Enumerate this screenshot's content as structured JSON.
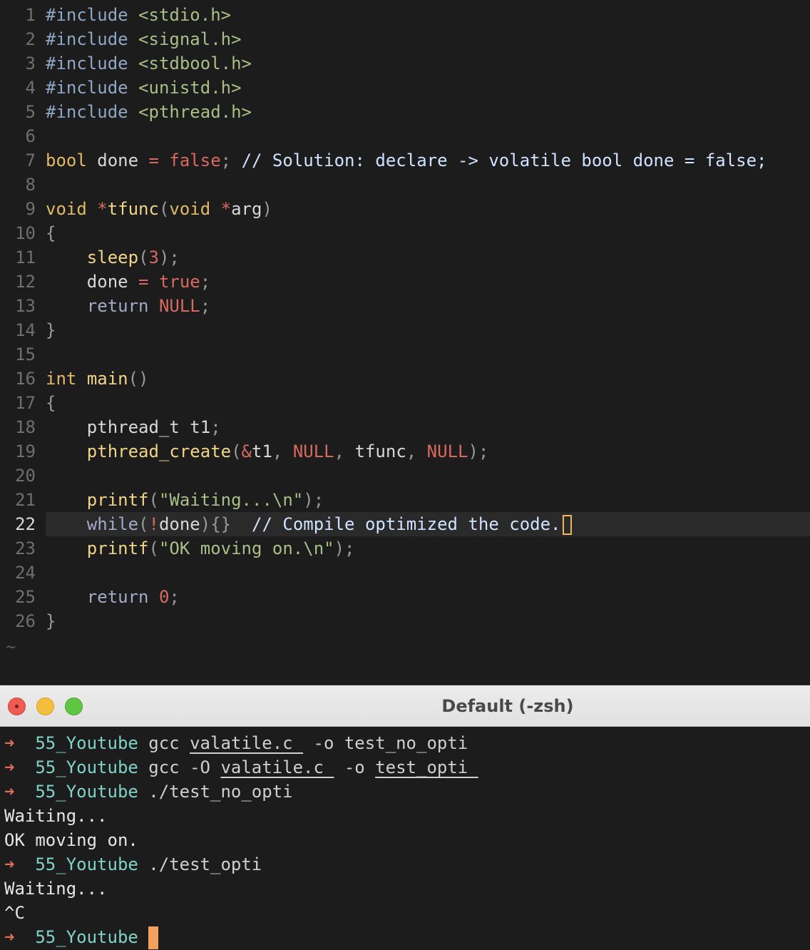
{
  "editor": {
    "lines": [
      {
        "n": "1",
        "parts": [
          [
            "pre",
            "#include "
          ],
          [
            "str",
            "<stdio.h>"
          ]
        ]
      },
      {
        "n": "2",
        "parts": [
          [
            "pre",
            "#include "
          ],
          [
            "str",
            "<signal.h>"
          ]
        ]
      },
      {
        "n": "3",
        "parts": [
          [
            "pre",
            "#include "
          ],
          [
            "str",
            "<stdbool.h>"
          ]
        ]
      },
      {
        "n": "4",
        "parts": [
          [
            "pre",
            "#include "
          ],
          [
            "str",
            "<unistd.h>"
          ]
        ]
      },
      {
        "n": "5",
        "parts": [
          [
            "pre",
            "#include "
          ],
          [
            "str",
            "<pthread.h>"
          ]
        ]
      },
      {
        "n": "6",
        "parts": []
      },
      {
        "n": "7",
        "parts": [
          [
            "type",
            "bool"
          ],
          [
            "txt",
            " done "
          ],
          [
            "op",
            "="
          ],
          [
            "txt",
            " "
          ],
          [
            "const",
            "false"
          ],
          [
            "punc",
            ";"
          ],
          [
            "txt",
            " "
          ],
          [
            "cmt",
            "// Solution: declare -> volatile bool done = false;"
          ]
        ]
      },
      {
        "n": "8",
        "parts": []
      },
      {
        "n": "9",
        "parts": [
          [
            "type",
            "void"
          ],
          [
            "txt",
            " "
          ],
          [
            "op",
            "*"
          ],
          [
            "fn",
            "tfunc"
          ],
          [
            "punc",
            "("
          ],
          [
            "type",
            "void"
          ],
          [
            "txt",
            " "
          ],
          [
            "op",
            "*"
          ],
          [
            "txt",
            "arg"
          ],
          [
            "punc",
            ")"
          ]
        ]
      },
      {
        "n": "10",
        "parts": [
          [
            "punc",
            "{"
          ]
        ]
      },
      {
        "n": "11",
        "parts": [
          [
            "txt",
            "    "
          ],
          [
            "fn",
            "sleep"
          ],
          [
            "punc",
            "("
          ],
          [
            "const",
            "3"
          ],
          [
            "punc",
            ");"
          ]
        ]
      },
      {
        "n": "12",
        "parts": [
          [
            "txt",
            "    done "
          ],
          [
            "op",
            "="
          ],
          [
            "txt",
            " "
          ],
          [
            "const",
            "true"
          ],
          [
            "punc",
            ";"
          ]
        ]
      },
      {
        "n": "13",
        "parts": [
          [
            "txt",
            "    "
          ],
          [
            "kw",
            "return"
          ],
          [
            "txt",
            " "
          ],
          [
            "const",
            "NULL"
          ],
          [
            "punc",
            ";"
          ]
        ]
      },
      {
        "n": "14",
        "parts": [
          [
            "punc",
            "}"
          ]
        ]
      },
      {
        "n": "15",
        "parts": []
      },
      {
        "n": "16",
        "parts": [
          [
            "type",
            "int"
          ],
          [
            "txt",
            " "
          ],
          [
            "fn",
            "main"
          ],
          [
            "punc",
            "()"
          ]
        ]
      },
      {
        "n": "17",
        "parts": [
          [
            "punc",
            "{"
          ]
        ]
      },
      {
        "n": "18",
        "parts": [
          [
            "txt",
            "    pthread_t t1"
          ],
          [
            "punc",
            ";"
          ]
        ]
      },
      {
        "n": "19",
        "parts": [
          [
            "txt",
            "    "
          ],
          [
            "fn",
            "pthread_create"
          ],
          [
            "punc",
            "("
          ],
          [
            "op",
            "&"
          ],
          [
            "txt",
            "t1"
          ],
          [
            "punc",
            ", "
          ],
          [
            "const",
            "NULL"
          ],
          [
            "punc",
            ", "
          ],
          [
            "txt",
            "tfunc"
          ],
          [
            "punc",
            ", "
          ],
          [
            "const",
            "NULL"
          ],
          [
            "punc",
            ");"
          ]
        ]
      },
      {
        "n": "20",
        "parts": []
      },
      {
        "n": "21",
        "parts": [
          [
            "txt",
            "    "
          ],
          [
            "fn",
            "printf"
          ],
          [
            "punc",
            "("
          ],
          [
            "str",
            "\"Waiting...\\n\""
          ],
          [
            "punc",
            ");"
          ]
        ]
      },
      {
        "n": "22",
        "current": true,
        "parts": [
          [
            "txt",
            "    "
          ],
          [
            "kw",
            "while"
          ],
          [
            "punc",
            "("
          ],
          [
            "op",
            "!"
          ],
          [
            "txt",
            "done"
          ],
          [
            "punc",
            "){}"
          ],
          [
            "txt",
            "  "
          ],
          [
            "cmt",
            "// Compile optimized the code."
          ]
        ]
      },
      {
        "n": "23",
        "parts": [
          [
            "txt",
            "    "
          ],
          [
            "fn",
            "printf"
          ],
          [
            "punc",
            "("
          ],
          [
            "str",
            "\"OK moving on.\\n\""
          ],
          [
            "punc",
            ");"
          ]
        ]
      },
      {
        "n": "24",
        "parts": []
      },
      {
        "n": "25",
        "parts": [
          [
            "txt",
            "    "
          ],
          [
            "kw",
            "return"
          ],
          [
            "txt",
            " "
          ],
          [
            "const",
            "0"
          ],
          [
            "punc",
            ";"
          ]
        ]
      },
      {
        "n": "26",
        "parts": [
          [
            "punc",
            "}"
          ]
        ]
      }
    ],
    "tilde": "~"
  },
  "terminal": {
    "title": "Default (-zsh)",
    "lines": [
      {
        "type": "prompt",
        "arrow": "➜",
        "dir": "55_Youtube",
        "cmd": [
          [
            "",
            " gcc "
          ],
          [
            "ul",
            "valatile.c "
          ],
          [
            "",
            " -o test_no_opti"
          ]
        ]
      },
      {
        "type": "prompt",
        "arrow": "➜",
        "dir": "55_Youtube",
        "cmd": [
          [
            "",
            " gcc -O "
          ],
          [
            "ul",
            "valatile.c "
          ],
          [
            "",
            " -o "
          ],
          [
            "ul",
            "test_opti "
          ]
        ]
      },
      {
        "type": "prompt",
        "arrow": "➜",
        "dir": "55_Youtube",
        "cmd": [
          [
            "",
            " ./test_no_opti"
          ]
        ]
      },
      {
        "type": "out",
        "text": "Waiting..."
      },
      {
        "type": "out",
        "text": "OK moving on."
      },
      {
        "type": "prompt",
        "arrow": "➜",
        "dir": "55_Youtube",
        "cmd": [
          [
            "",
            " ./test_opti"
          ]
        ]
      },
      {
        "type": "out",
        "text": "Waiting..."
      },
      {
        "type": "out",
        "text": "^C"
      },
      {
        "type": "prompt",
        "arrow": "➜",
        "dir": "55_Youtube",
        "cmd": [
          [
            "",
            " "
          ]
        ],
        "cursor": true
      }
    ]
  }
}
